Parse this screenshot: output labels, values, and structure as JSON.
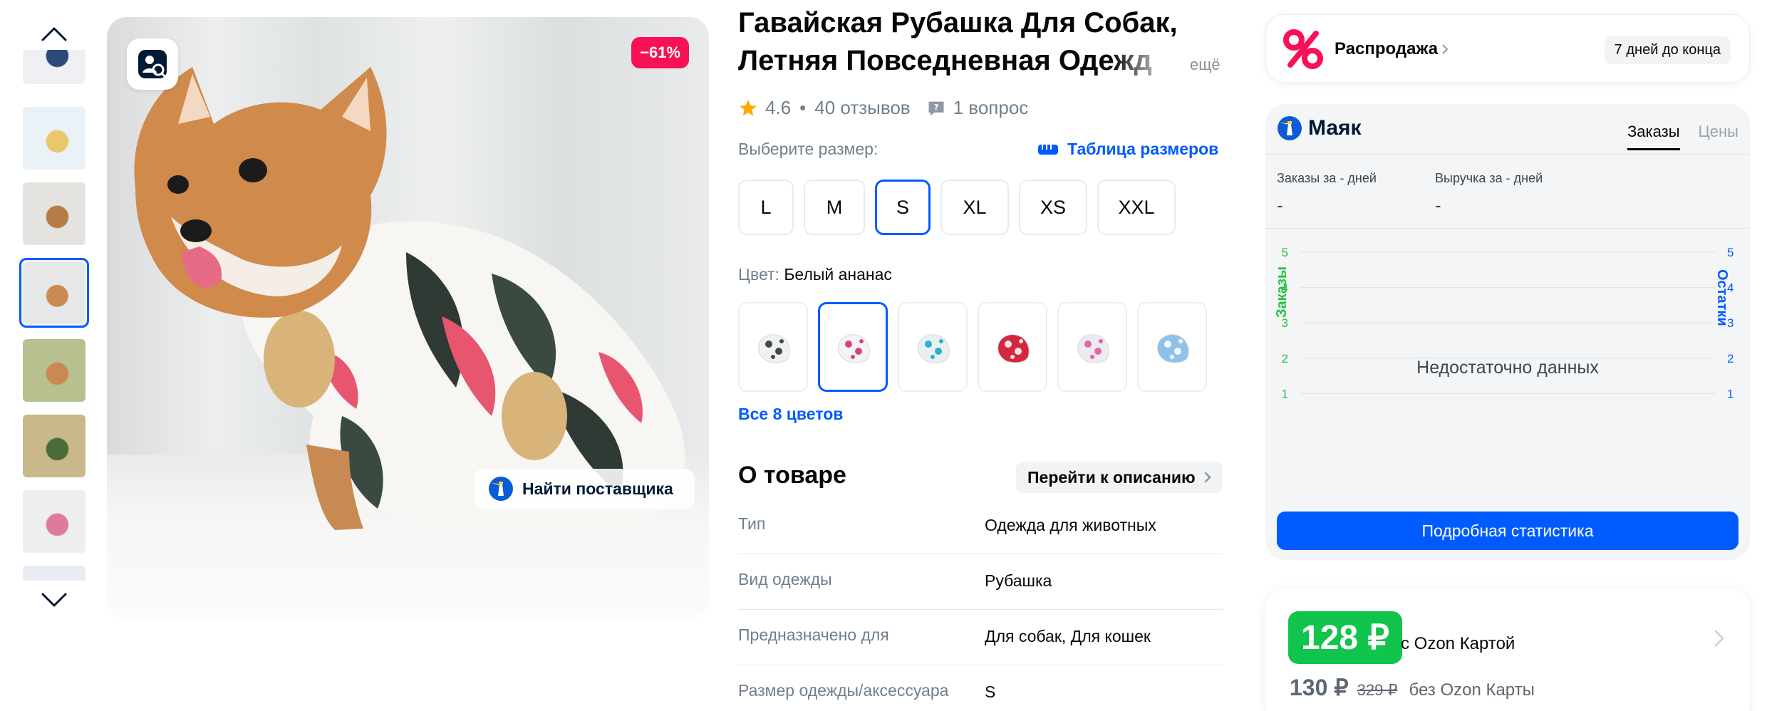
{
  "gallery": {
    "thumbnails": [
      {
        "name": "thumb-shirt-white",
        "bg": "#eef0f4",
        "accent": "#2b4a7a",
        "active": false
      },
      {
        "name": "thumb-size-chart",
        "bg": "#eaf2f8",
        "accent": "#e8c86a",
        "active": false
      },
      {
        "name": "thumb-dog-standing",
        "bg": "#e4e3e0",
        "accent": "#b57c45",
        "active": false
      },
      {
        "name": "thumb-dog-sitting",
        "bg": "#e6e7e8",
        "accent": "#c88a52",
        "active": true
      },
      {
        "name": "thumb-dog-grass",
        "bg": "#b9c08f",
        "accent": "#c88a52",
        "active": false
      },
      {
        "name": "thumb-dog-outdoor",
        "bg": "#c8b88a",
        "accent": "#4a6b3a",
        "active": false
      },
      {
        "name": "thumb-dog-white-bg",
        "bg": "#eeeeee",
        "accent": "#e07a9a",
        "active": false
      },
      {
        "name": "thumb-shirt-blue",
        "bg": "#e9ecf2",
        "accent": "#2b4a7a",
        "active": false
      }
    ],
    "discount_badge": "−61%",
    "supplier_button": "Найти поставщика"
  },
  "product": {
    "title_line1": "Гавайская Рубашка Для Собак,",
    "title_line2": "Летняя Повседневная Одежд",
    "title_more": "ещё",
    "rating": "4.6",
    "reviews": "40 отзывов",
    "questions": "1 вопрос",
    "size_label": "Выберите размер:",
    "size_table_link": "Таблица размеров",
    "sizes": [
      {
        "label": "L",
        "active": false
      },
      {
        "label": "M",
        "active": false
      },
      {
        "label": "S",
        "active": true
      },
      {
        "label": "XL",
        "active": false
      },
      {
        "label": "XS",
        "active": false
      },
      {
        "label": "XXL",
        "active": false
      }
    ],
    "color_label": "Цвет:",
    "color_value": "Белый ананас",
    "swatches": [
      {
        "primary": "#f1f1ef",
        "secondary": "#3f4a44",
        "active": false
      },
      {
        "primary": "#f4f4f6",
        "secondary": "#d9437a",
        "active": true
      },
      {
        "primary": "#e9f0f3",
        "secondary": "#2ab2c8",
        "active": false
      },
      {
        "primary": "#d4263d",
        "secondary": "#f3e6e0",
        "active": false
      },
      {
        "primary": "#eceaf3",
        "secondary": "#e06b9c",
        "active": false
      },
      {
        "primary": "#8ec2ea",
        "secondary": "#f4f7fb",
        "active": false
      }
    ],
    "all_colors": "Все 8 цветов",
    "about_title": "О товаре",
    "goto_description": "Перейти к описанию",
    "specs": [
      {
        "key": "Тип",
        "value": "Одежда для животных"
      },
      {
        "key": "Вид одежды",
        "value": "Рубашка"
      },
      {
        "key": "Предназначено для",
        "value": "Для собак, Для кошек"
      },
      {
        "key": "Размер одежды/аксессуара",
        "value": "S"
      }
    ]
  },
  "sale": {
    "label": "Распродажа",
    "days_left": "7 дней до конца"
  },
  "mayak": {
    "brand": "Маяк",
    "tabs": [
      {
        "label": "Заказы",
        "active": true
      },
      {
        "label": "Цены",
        "active": false
      }
    ],
    "orders_label": "Заказы за - дней",
    "orders_value": "-",
    "revenue_label": "Выручка за - дней",
    "revenue_value": "-",
    "no_data": "Недостаточно данных",
    "stats_button": "Подробная статистика",
    "left_axis_title": "Заказы",
    "right_axis_title": "Остатки",
    "left_color": "#22c23d",
    "right_color": "#005bff"
  },
  "chart_data": {
    "type": "line",
    "title": "",
    "ylabel": "Заказы",
    "y2label": "Остатки",
    "yticks": [
      0,
      1,
      2,
      3,
      4,
      5
    ],
    "y2ticks": [
      0,
      1,
      2,
      3,
      4,
      5
    ],
    "ylim": [
      0,
      5
    ],
    "series": [],
    "annotation": "Недостаточно данных",
    "grid": true
  },
  "price": {
    "ozon_card_price": "128 ₽",
    "ozon_card_label": "с Ozon Картой",
    "regular_price": "130 ₽",
    "old_price": "329 ₽",
    "regular_label": "без Ozon Карты",
    "badge_color": "#10c44c"
  }
}
